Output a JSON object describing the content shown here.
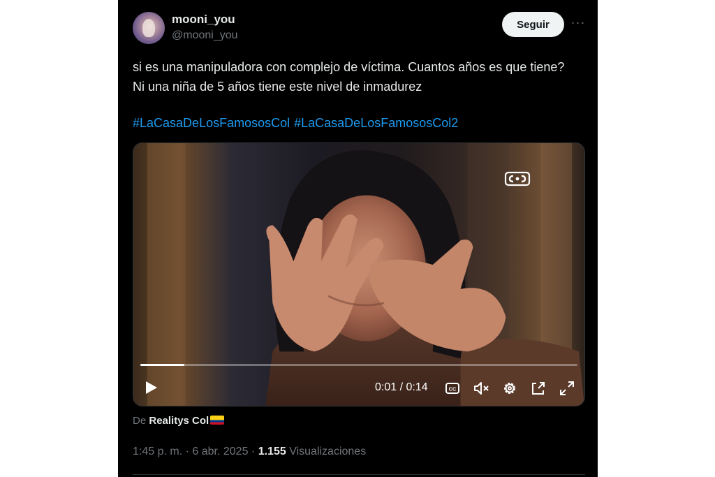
{
  "user": {
    "display_name": "mooni_you",
    "handle": "@mooni_you"
  },
  "follow_label": "Seguir",
  "more_label": "···",
  "tweet": {
    "text": "si es una manipuladora con complejo de víctima. Cuantos años es que tiene? Ni una niña de 5 años tiene este nivel de inmadurez",
    "hashtags": [
      "#LaCasaDeLosFamososCol",
      "#LaCasaDeLosFamososCol2"
    ]
  },
  "video": {
    "time_display": "0:01 / 0:14",
    "progress_fraction": 0.1,
    "watermark_icon": "canal-rcn-logo-icon",
    "controls": [
      "play-icon",
      "captions-icon",
      "mute-icon",
      "settings-icon",
      "pip-icon",
      "fullscreen-icon"
    ]
  },
  "source": {
    "prefix": "De",
    "name": "Realitys Col",
    "flag_icon": "colombia-flag-icon"
  },
  "meta": {
    "time": "1:45 p. m.",
    "sep1": "·",
    "date": "6 abr. 2025",
    "sep2": "·",
    "views_count": "1.155",
    "views_label": "Visualizaciones"
  },
  "colors": {
    "background": "#000000",
    "text": "#e7e9ea",
    "muted": "#71767b",
    "link": "#1d9bf0",
    "follow_bg": "#eff3f4"
  }
}
